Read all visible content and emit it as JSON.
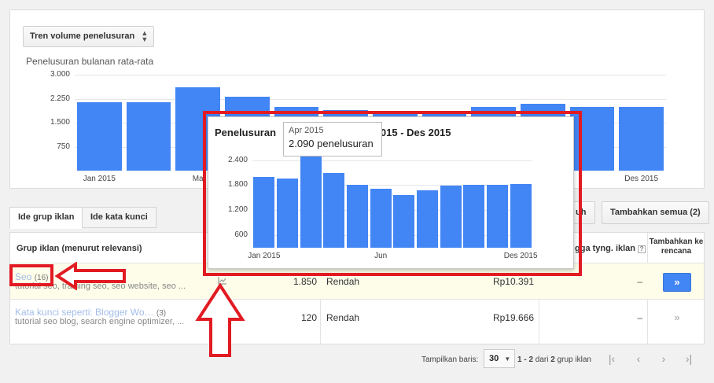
{
  "top_chart": {
    "dropdown_label": "Tren volume penelusuran",
    "title": "Penelusuran bulanan rata-rata",
    "chart_data": {
      "type": "bar",
      "categories": [
        "Jan 2015",
        "Feb 2015",
        "Mar 2015",
        "Apr 2015",
        "Mei 2015",
        "Jun 2015",
        "Jul 2015",
        "Agu 2015",
        "Sep 2015",
        "Okt 2015",
        "Nov 2015",
        "Des 2015"
      ],
      "values": [
        2150,
        2150,
        2600,
        2300,
        2000,
        1900,
        1800,
        1850,
        2000,
        2100,
        2000,
        2000
      ],
      "ylim": [
        0,
        3000
      ],
      "yticks": [
        "3.000",
        "2.250",
        "1.500",
        "750"
      ],
      "xtick_labels": [
        "Jan 2015",
        "Ma",
        "Des 2015"
      ]
    }
  },
  "tabs": {
    "ad_groups": "Ide grup iklan",
    "keywords": "Ide kata kunci"
  },
  "buttons": {
    "hidden_partial": "uh",
    "add_all": "Tambahkan semua (2)"
  },
  "table": {
    "headers": {
      "ad_group": "Grup iklan (menurut relevansi)",
      "bid": "gga tyng. iklan",
      "add_to_plan": "Tambahkan ke rencana"
    },
    "rows": [
      {
        "name": "Seo",
        "count": "(16)",
        "keywords": "tutorial seo, training seo, seo website, seo ...",
        "searches": "1.850",
        "competition": "Rendah",
        "bid": "Rp10.391",
        "share": "–",
        "add_label": "»"
      },
      {
        "name": "Kata kunci seperti: Blogger Wo…",
        "count": "(3)",
        "keywords": "tutorial seo blog, search engine optimizer, ...",
        "searches": "120",
        "competition": "Rendah",
        "bid": "Rp19.666",
        "share": "–",
        "add_label": "»"
      }
    ]
  },
  "footer": {
    "show_rows_label": "Tampilkan baris:",
    "rows_value": "30",
    "range_bold": "1 - 2",
    "range_middle": " dari ",
    "total_bold": "2",
    "range_suffix": " grup iklan"
  },
  "popup": {
    "title_left": "Penelusuran",
    "title_right": "2015 - Des 2015",
    "tooltip_date": "Apr 2015",
    "tooltip_value": "2.090 penelusuran",
    "chart_data": {
      "type": "bar",
      "categories": [
        "Jan 2015",
        "Feb 2015",
        "Mar 2015",
        "Apr 2015",
        "Mei 2015",
        "Jun 2015",
        "Jul 2015",
        "Agu 2015",
        "Sep 2015",
        "Okt 2015",
        "Nov 2015",
        "Des 2015"
      ],
      "values": [
        1990,
        1960,
        2500,
        2090,
        1800,
        1720,
        1560,
        1680,
        1780,
        1810,
        1800,
        1830
      ],
      "ylim": [
        300,
        2600
      ],
      "yticks": [
        "2.400",
        "1.800",
        "1.200",
        "600"
      ],
      "xtick_labels": [
        "Jan 2015",
        "Jun",
        "Des 2015"
      ]
    }
  },
  "colors": {
    "bar": "#4285f4",
    "annotation_red": "#e21b23",
    "link": "#a3bde9"
  }
}
